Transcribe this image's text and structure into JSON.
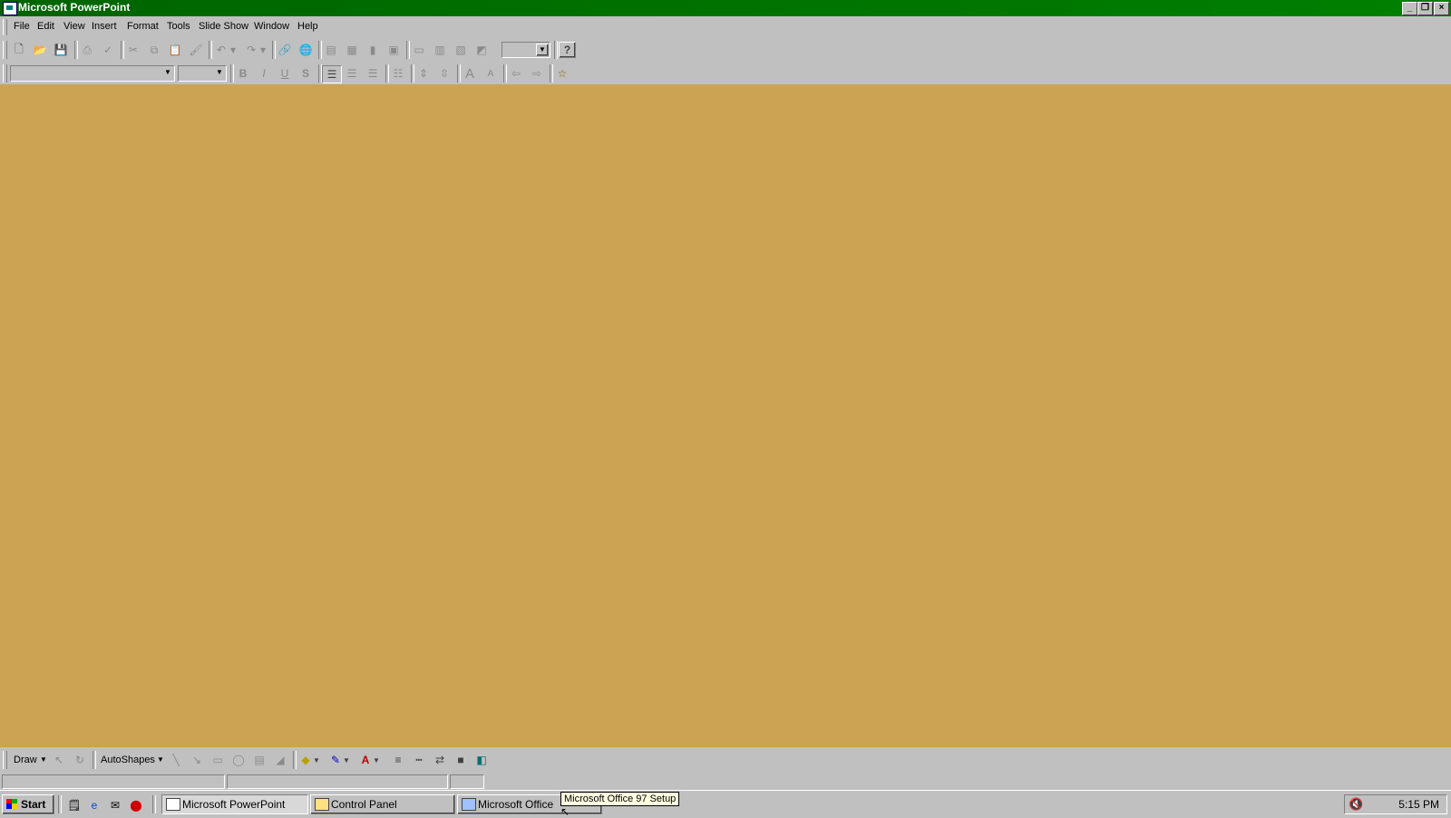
{
  "window": {
    "title": "Microsoft PowerPoint"
  },
  "menu": [
    {
      "label": "File"
    },
    {
      "label": "Edit"
    },
    {
      "label": "View"
    },
    {
      "label": "Insert"
    },
    {
      "label": "Format"
    },
    {
      "label": "Tools"
    },
    {
      "label": "Slide Show"
    },
    {
      "label": "Window"
    },
    {
      "label": "Help"
    }
  ],
  "drawing_toolbar": {
    "draw_label": "Draw",
    "autoshapes_label": "AutoShapes"
  },
  "taskbar": {
    "start_label": "Start",
    "tasks": [
      {
        "label": "Microsoft PowerPoint"
      },
      {
        "label": "Control Panel"
      },
      {
        "label": "Microsoft Office"
      }
    ],
    "clock": "5:15 PM"
  },
  "tooltip": "Microsoft Office 97 Setup",
  "colors": {
    "titlebar": "#008000",
    "workspace": "#cba353"
  }
}
